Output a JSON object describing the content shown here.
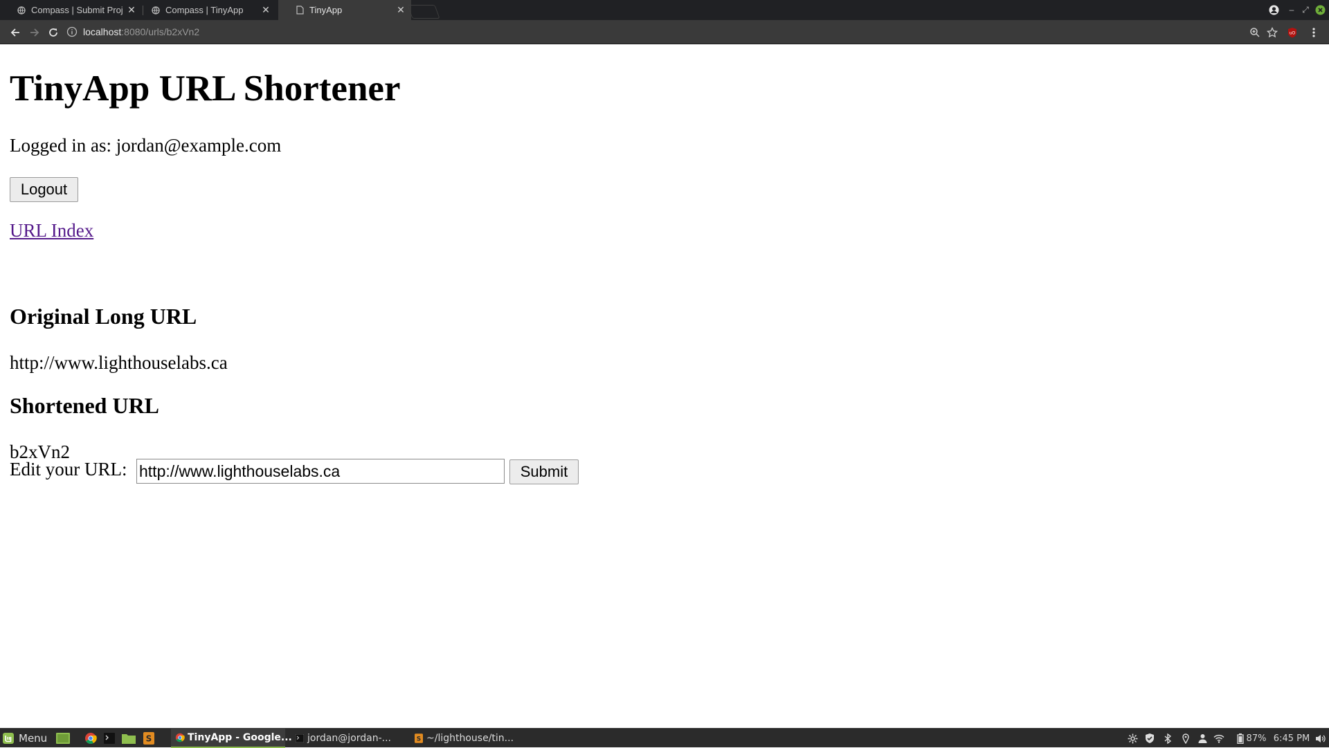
{
  "browser": {
    "tabs": [
      {
        "title": "Compass | Submit Proj",
        "active": false
      },
      {
        "title": "Compass | TinyApp",
        "active": false
      },
      {
        "title": "TinyApp",
        "active": true
      }
    ],
    "address": {
      "host": "localhost",
      "path": ":8080/urls/b2xVn2"
    }
  },
  "page": {
    "title": "TinyApp URL Shortener",
    "logged_in": "Logged in as: jordan@example.com",
    "logout_label": "Logout",
    "index_link": "URL Index",
    "original_heading": "Original Long URL",
    "original_url": "http://www.lighthouselabs.ca",
    "short_heading": "Shortened URL",
    "short_id": "b2xVn2",
    "edit_label": "Edit your URL:",
    "edit_value": "http://www.lighthouselabs.ca",
    "submit_label": "Submit"
  },
  "taskbar": {
    "menu_label": "Menu",
    "windows": [
      {
        "title": "TinyApp - Google...",
        "active": true
      },
      {
        "title": "jordan@jordan-...",
        "active": false
      },
      {
        "title": "~/lighthouse/tin...",
        "active": false
      }
    ],
    "battery": "87%",
    "clock": "6:45 PM"
  },
  "colors": {
    "link_visited": "#551a8b",
    "chrome_dark": "#202124",
    "toolbar": "#3a3a3a",
    "taskbar": "#2b2b2b"
  }
}
